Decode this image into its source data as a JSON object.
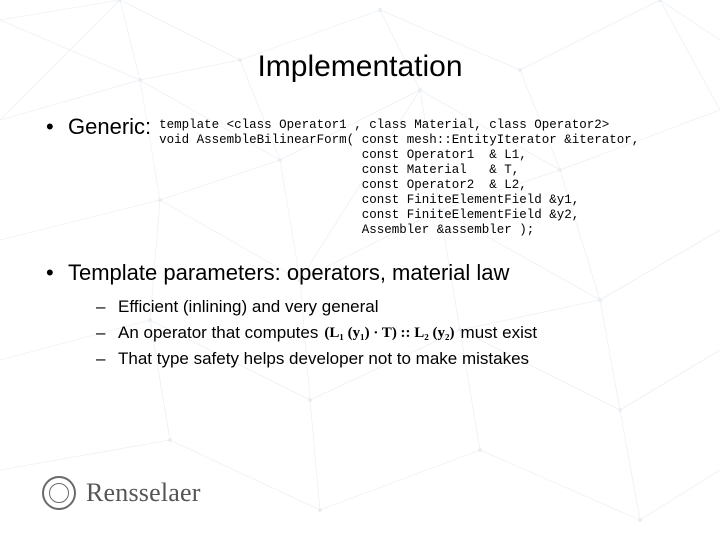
{
  "title": "Implementation",
  "bullets": {
    "generic_label": "Generic:",
    "code": "template <class Operator1 , class Material, class Operator2>\nvoid AssembleBilinearForm( const mesh::EntityIterator &iterator,\n                           const Operator1  & L1,\n                           const Material   & T,\n                           const Operator2  & L2,\n                           const FiniteElementField &y1,\n                           const FiniteElementField &y2,\n                           Assembler &assembler );",
    "template_label": "Template parameters: operators, material law",
    "subs": {
      "s1": "Efficient (inlining) and very general",
      "s2a": "An operator that computes",
      "s2_formula": "(L₁ (y₁) · T) :: L₂ (y₂)",
      "s2b": " must exist",
      "s3": "That type safety helps developer not to make mistakes"
    }
  },
  "logo": {
    "name": "Rensselaer"
  }
}
